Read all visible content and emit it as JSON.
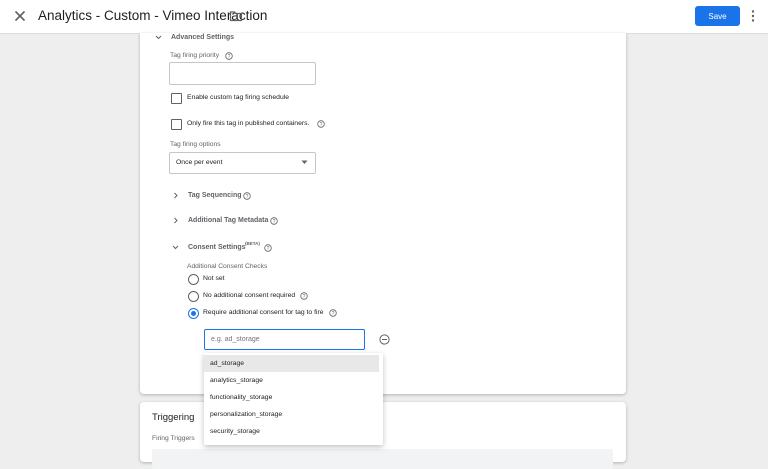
{
  "header": {
    "title": "Analytics - Custom - Vimeo Interaction",
    "save_label": "Save"
  },
  "advanced": {
    "heading": "Advanced Settings",
    "priority_label": "Tag firing priority",
    "priority_value": "",
    "schedule_label": "Enable custom tag firing schedule",
    "published_label": "Only fire this tag in published containers.",
    "options_label": "Tag firing options",
    "options_value": "Once per event",
    "sequencing_label": "Tag Sequencing",
    "metadata_label": "Additional Tag Metadata",
    "consent_label": "Consent Settings",
    "consent_badge": "(BETA)",
    "checks_label": "Additional Consent Checks",
    "radios": [
      {
        "label": "Not set",
        "selected": false
      },
      {
        "label": "No additional consent required",
        "selected": false
      },
      {
        "label": "Require additional consent for tag to fire",
        "selected": true
      }
    ],
    "consent_input_placeholder": "e.g. ad_storage",
    "consent_options": [
      "ad_storage",
      "analytics_storage",
      "functionality_storage",
      "personalization_storage",
      "security_storage"
    ]
  },
  "triggering": {
    "heading": "Triggering",
    "firing_label": "Firing Triggers"
  },
  "colors": {
    "accent": "#1a73e8",
    "background": "#eeeeee"
  }
}
